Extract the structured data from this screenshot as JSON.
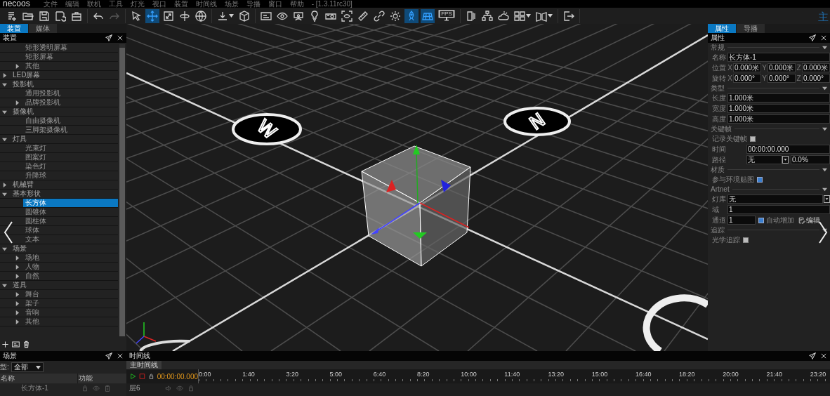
{
  "menu_bar": {
    "logo": "necoos",
    "items": [
      "文件",
      "编辑",
      "联机",
      "工具",
      "灯光",
      "视口",
      "装置",
      "时间线",
      "场景",
      "导播",
      "窗口",
      "帮助"
    ],
    "version": "- [1.3.11rc30]"
  },
  "toolbar": {
    "groups": [
      {
        "buttons": [
          {
            "kind": "button",
            "selected": false,
            "disabled": false
          },
          {
            "kind": "button",
            "selected": false,
            "disabled": false
          },
          {
            "kind": "button",
            "selected": false,
            "disabled": false
          },
          {
            "kind": "button",
            "selected": false,
            "disabled": false
          },
          {
            "kind": "button",
            "selected": false,
            "disabled": false
          }
        ]
      },
      {
        "buttons": [
          {
            "kind": "button",
            "selected": false,
            "disabled": false
          },
          {
            "kind": "button",
            "selected": false,
            "disabled": true
          }
        ]
      },
      {
        "buttons": [
          {
            "kind": "button",
            "selected": false,
            "disabled": false
          },
          {
            "kind": "button",
            "selected": true,
            "disabled": false
          },
          {
            "kind": "button",
            "selected": false,
            "disabled": false
          },
          {
            "kind": "button",
            "selected": false,
            "disabled": false
          },
          {
            "kind": "button",
            "selected": false,
            "disabled": false
          }
        ]
      },
      {
        "buttons": [
          {
            "kind": "dropdown",
            "selected": false,
            "disabled": false
          },
          {
            "kind": "button",
            "selected": false,
            "disabled": false
          }
        ]
      },
      {
        "buttons": [
          {
            "kind": "button",
            "selected": false,
            "disabled": false
          },
          {
            "kind": "button",
            "selected": false,
            "disabled": false
          },
          {
            "kind": "button",
            "selected": false,
            "disabled": false
          },
          {
            "kind": "button",
            "selected": false,
            "disabled": false
          },
          {
            "kind": "button",
            "selected": false,
            "disabled": false
          },
          {
            "kind": "button",
            "selected": false,
            "disabled": false
          },
          {
            "kind": "button",
            "selected": false,
            "disabled": false
          },
          {
            "kind": "button",
            "selected": false,
            "disabled": false
          },
          {
            "kind": "button",
            "selected": false,
            "disabled": false
          },
          {
            "kind": "button",
            "selected": true,
            "disabled": false
          },
          {
            "kind": "button",
            "selected": true,
            "disabled": false
          },
          {
            "kind": "button",
            "selected": false,
            "disabled": false,
            "label": "FPS"
          }
        ]
      },
      {
        "buttons": [
          {
            "kind": "button",
            "selected": false,
            "disabled": false
          },
          {
            "kind": "button",
            "selected": false,
            "disabled": false
          },
          {
            "kind": "button",
            "selected": false,
            "disabled": false
          },
          {
            "kind": "dropdown",
            "selected": false,
            "disabled": false
          },
          {
            "kind": "dropdown",
            "selected": false,
            "disabled": false
          }
        ]
      },
      {
        "buttons": [
          {
            "kind": "button",
            "selected": false,
            "disabled": false
          }
        ]
      }
    ]
  },
  "workspace_label": "主",
  "left_panel": {
    "tabs": [
      {
        "label": "装置",
        "selected": true
      },
      {
        "label": "媒体",
        "selected": false
      }
    ],
    "title": "装置",
    "tree": [
      {
        "children": [
          {
            "label": "矩形透明屏幕",
            "selected": false
          },
          {
            "label": "矩形屏幕",
            "selected": false
          },
          {
            "label": "其他",
            "selected": false,
            "expanded": false
          }
        ]
      },
      {
        "label": "LED屏幕",
        "selected": false,
        "expanded": false
      },
      {
        "label": "投影机",
        "selected": false,
        "expanded": true,
        "children": [
          {
            "label": "通用投影机",
            "selected": false
          },
          {
            "label": "品牌投影机",
            "selected": false,
            "expanded": false
          }
        ]
      },
      {
        "label": "摄像机",
        "selected": false,
        "expanded": true,
        "children": [
          {
            "label": "自由摄像机",
            "selected": false
          },
          {
            "label": "三脚架摄像机",
            "selected": false
          }
        ]
      },
      {
        "label": "灯具",
        "selected": false,
        "expanded": true,
        "children": [
          {
            "label": "光束灯",
            "selected": false
          },
          {
            "label": "图案灯",
            "selected": false
          },
          {
            "label": "染色灯",
            "selected": false
          },
          {
            "label": "升降球",
            "selected": false
          }
        ]
      },
      {
        "label": "机械臂",
        "selected": false,
        "expanded": false
      },
      {
        "label": "基本形状",
        "selected": false,
        "expanded": true,
        "children": [
          {
            "label": "长方体",
            "selected": true
          },
          {
            "label": "圆锥体",
            "selected": false
          },
          {
            "label": "圆柱体",
            "selected": false
          },
          {
            "label": "球体",
            "selected": false
          },
          {
            "label": "文本",
            "selected": false
          }
        ]
      },
      {
        "label": "场景",
        "selected": false,
        "expanded": true,
        "children": [
          {
            "label": "场地",
            "selected": false,
            "expanded": false
          },
          {
            "label": "人物",
            "selected": false,
            "expanded": false
          },
          {
            "label": "自然",
            "selected": false,
            "expanded": false
          }
        ]
      },
      {
        "label": "道具",
        "selected": false,
        "expanded": true,
        "children": [
          {
            "label": "舞台",
            "selected": false,
            "expanded": false
          },
          {
            "label": "架子",
            "selected": false,
            "expanded": false
          },
          {
            "label": "音响",
            "selected": false,
            "expanded": false
          },
          {
            "label": "其他",
            "selected": false,
            "expanded": false
          }
        ]
      }
    ]
  },
  "viewport": {
    "markers": [
      {
        "letter": "W"
      },
      {
        "letter": "N"
      }
    ]
  },
  "right_panel": {
    "tabs": [
      {
        "label": "属性",
        "selected": true
      },
      {
        "label": "导播",
        "selected": false
      }
    ],
    "title": "属性",
    "sections": [
      {
        "title": "常规",
        "rows": [
          {
            "kind": "text",
            "label": "名称",
            "value": "长方体-1"
          },
          {
            "kind": "xyz",
            "label": "位置",
            "fields": [
              {
                "axis": "X",
                "value": "0.000米"
              },
              {
                "axis": "Y",
                "value": "0.000米"
              },
              {
                "axis": "Z",
                "value": "0.000米"
              }
            ]
          },
          {
            "kind": "xyz",
            "label": "旋转",
            "fields": [
              {
                "axis": "X",
                "value": "0.000°"
              },
              {
                "axis": "Y",
                "value": "0.000°"
              },
              {
                "axis": "Z",
                "value": "0.000°"
              }
            ]
          }
        ]
      },
      {
        "title": "类型",
        "rows": [
          {
            "kind": "text",
            "label": "长度",
            "value": "1.000米"
          },
          {
            "kind": "text",
            "label": "宽度",
            "value": "1.000米"
          },
          {
            "kind": "text",
            "label": "高度",
            "value": "1.000米"
          }
        ]
      },
      {
        "title": "关键帧",
        "rows": [
          {
            "kind": "checkbox",
            "label": "记录关键帧",
            "checked": false
          },
          {
            "kind": "spin",
            "label": "时间",
            "value": "00:00:00.000"
          },
          {
            "kind": "path",
            "label": "路径",
            "value": "无",
            "percent": "0.0%"
          }
        ]
      },
      {
        "title": "材质",
        "rows": [
          {
            "kind": "checkbox",
            "label": "参与环境贴图",
            "checked": true
          }
        ]
      },
      {
        "title": "Artnet",
        "rows": [
          {
            "kind": "select",
            "label": "灯库",
            "value": "无"
          },
          {
            "kind": "text",
            "label": "域",
            "value": "1"
          },
          {
            "kind": "channel",
            "label": "通道",
            "value": "1",
            "auto_label": "自动增加",
            "auto_checked": true,
            "edit": "编辑"
          }
        ]
      },
      {
        "title": "追踪",
        "rows": [
          {
            "kind": "checkbox",
            "label": "光学追踪",
            "checked": false
          }
        ]
      }
    ]
  },
  "scene_panel": {
    "title": "场景",
    "filter": {
      "label": "型:",
      "value": "全部"
    },
    "columns": [
      "名称",
      "功能"
    ],
    "rows": [
      {
        "name": "长方体-1"
      }
    ]
  },
  "timeline": {
    "title": "时间线",
    "tabs": [
      {
        "label": "主时间线",
        "selected": true
      }
    ],
    "time": "00:00:00.000",
    "ruler": [
      "0:00",
      "1:40",
      "3:20",
      "5:00",
      "6:40",
      "8:20",
      "10:00",
      "11:40",
      "13:20",
      "15:00",
      "16:40",
      "18:20",
      "20:00",
      "21:40",
      "23:20"
    ],
    "layers": [
      {
        "name": "层6"
      }
    ]
  }
}
